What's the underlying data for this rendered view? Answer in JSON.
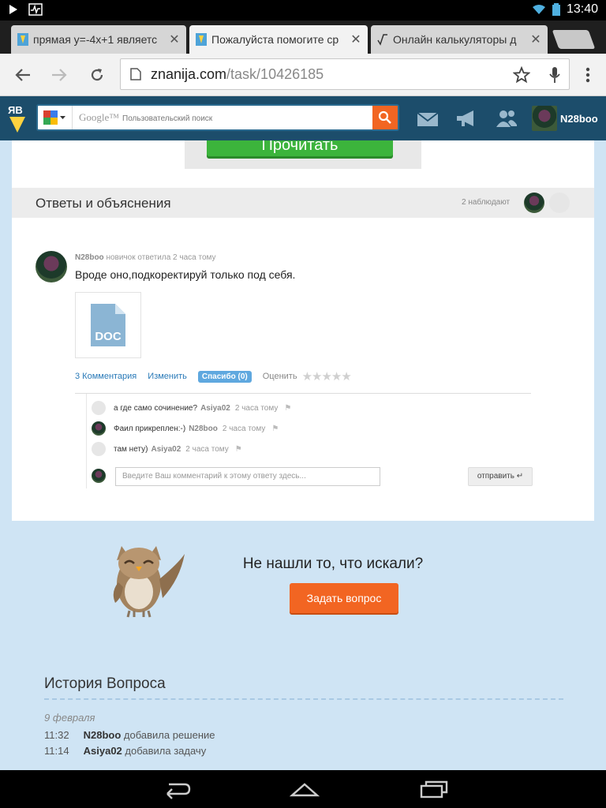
{
  "status": {
    "time": "13:40"
  },
  "tabs": [
    {
      "title": "прямая у=-4х+1 являетс"
    },
    {
      "title": "Пожалуйста помогите ср"
    },
    {
      "title": "Онлайн калькуляторы д"
    }
  ],
  "omnibox": {
    "host": "znanija.com",
    "path": "/task/10426185"
  },
  "header": {
    "search_brand": "Google™",
    "search_placeholder": "Пользовательский поиск",
    "username": "N28boo"
  },
  "ad": {
    "button_label": "Прочитать"
  },
  "answers": {
    "title": "Ответы и объяснения",
    "watchers": "2 наблюдают"
  },
  "answer": {
    "author": "N28boo",
    "meta": "новичок ответила 2 часа тому",
    "text": "Вроде оно,подкоректируй только под себя.",
    "attachment_label": "DOC",
    "actions": {
      "comments": "3 Комментария",
      "edit": "Изменить",
      "thanks": "Спасибо (0)",
      "rate": "Оценить",
      "stars": "★★★★★"
    }
  },
  "comments": [
    {
      "text": "а где само сочинение?",
      "user": "Asiya02",
      "time": "2 часа тому"
    },
    {
      "text": "Фаил прикреплен:-)",
      "user": "N28boo",
      "time": "2 часа тому"
    },
    {
      "text": "там нету)",
      "user": "Asiya02",
      "time": "2 часа тому"
    }
  ],
  "comment_input": {
    "placeholder": "Введите Ваш комментарий к этому ответу здесь...",
    "send": "отправить"
  },
  "notfound": {
    "title": "Не нашли то, что искали?",
    "button": "Задать вопрос"
  },
  "history": {
    "title": "История Вопроса",
    "date": "9 февраля",
    "rows": [
      {
        "time": "11:32",
        "user": "N28boo",
        "action": "добавила решение"
      },
      {
        "time": "11:14",
        "user": "Asiya02",
        "action": "добавила задачу"
      }
    ]
  },
  "colors": {
    "header": "#1c4d6b",
    "accent": "#f26522",
    "page_bg": "#cfe4f4",
    "link": "#2a7ab8"
  }
}
